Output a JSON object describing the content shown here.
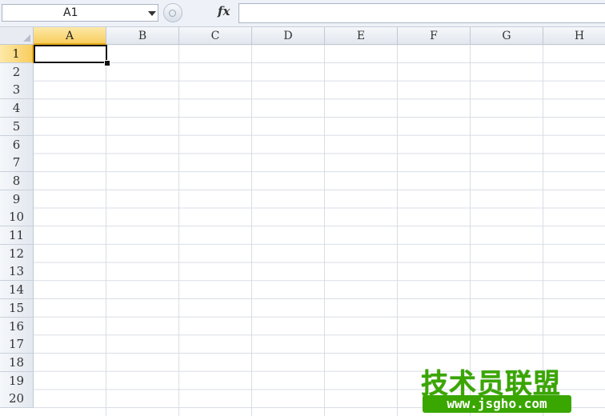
{
  "formula_bar": {
    "name_box_value": "A1",
    "fx_label": "fx",
    "formula_value": ""
  },
  "columns": [
    "A",
    "B",
    "C",
    "D",
    "E",
    "F",
    "G",
    "H"
  ],
  "rows": [
    "1",
    "2",
    "3",
    "4",
    "5",
    "6",
    "7",
    "8",
    "9",
    "10",
    "11",
    "12",
    "13",
    "14",
    "15",
    "16",
    "17",
    "18",
    "19",
    "20"
  ],
  "active_cell": "A1",
  "watermark": {
    "title": "技术员联盟",
    "url": "www.jsgho.com"
  },
  "colors": {
    "active_header": "#f8cd5e",
    "grid_line": "#d8dde4",
    "watermark_green": "#3aa600"
  }
}
